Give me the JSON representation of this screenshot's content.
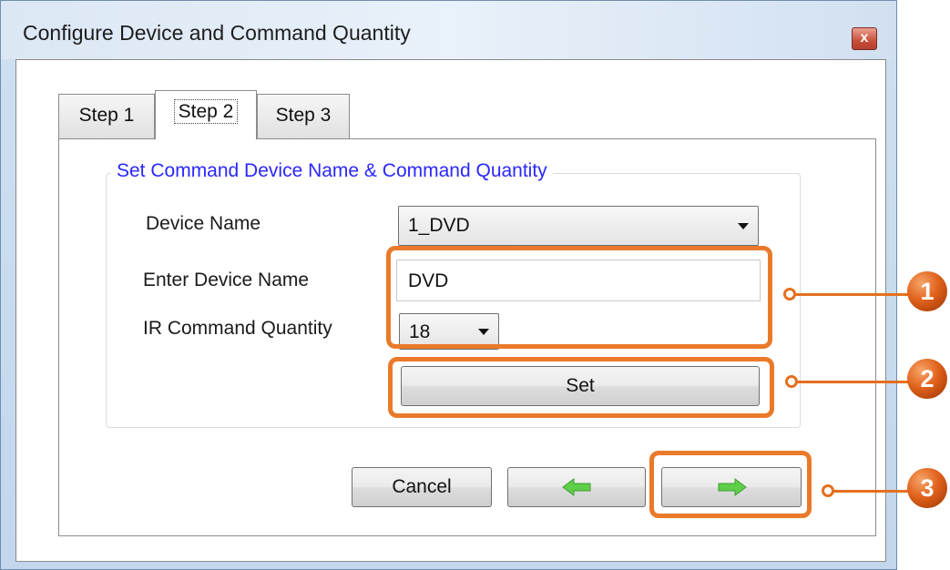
{
  "window": {
    "title": "Configure Device and Command Quantity",
    "close_glyph": "x"
  },
  "tabs": [
    {
      "label": "Step 1",
      "active": false
    },
    {
      "label": "Step 2",
      "active": true
    },
    {
      "label": "Step 3",
      "active": false
    }
  ],
  "group": {
    "legend": "Set Command Device Name & Command Quantity",
    "device_name_label": "Device Name",
    "device_name_value": "1_DVD",
    "enter_name_label": "Enter Device Name",
    "enter_name_value": "DVD",
    "ir_quantity_label": "IR Command Quantity",
    "ir_quantity_value": "18",
    "set_button": "Set"
  },
  "footer": {
    "cancel": "Cancel",
    "back_icon": "left-arrow-icon",
    "next_icon": "right-arrow-icon"
  },
  "callouts": [
    {
      "number": "1"
    },
    {
      "number": "2"
    },
    {
      "number": "3"
    }
  ],
  "colors": {
    "highlight": "#ea7a2a",
    "legend_text": "#2a27ff",
    "arrow_green": "#5fcf4a"
  }
}
